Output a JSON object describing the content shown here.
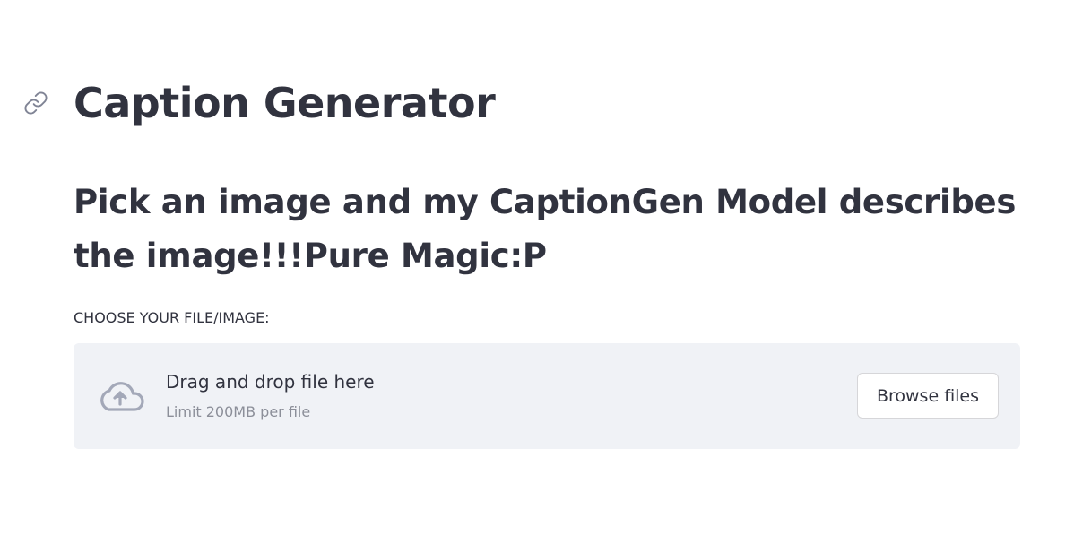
{
  "header": {
    "title": "Caption Generator",
    "anchor_icon": "link-icon"
  },
  "main": {
    "subtitle": "Pick an image and my CaptionGen Model describes the image!!!Pure Magic:P"
  },
  "uploader": {
    "label": "CHOOSE YOUR FILE/IMAGE:",
    "drop_text": "Drag and drop file here",
    "limit_text": "Limit 200MB per file",
    "browse_label": "Browse files",
    "icon": "cloud-upload-icon"
  },
  "colors": {
    "text": "#31333f",
    "dropzone_bg": "#f0f2f6",
    "muted": "#8c8f99",
    "icon": "#a3a8b8"
  }
}
